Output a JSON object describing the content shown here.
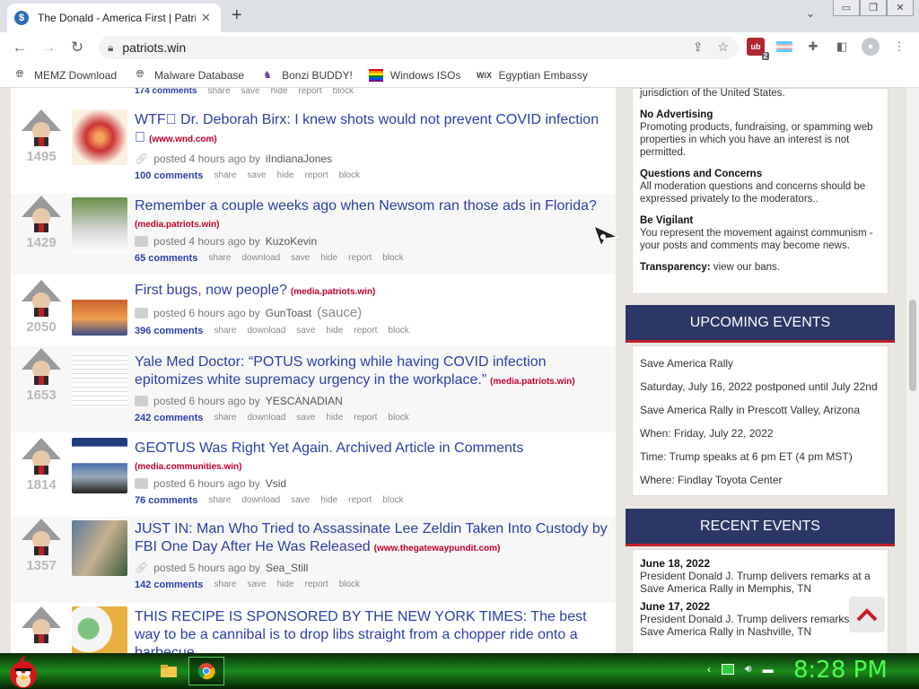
{
  "browser": {
    "tab_title": "The Donald - America First | Patriots.win",
    "tab_favicon_letter": "$",
    "url": "patriots.win",
    "window_buttons": [
      "▭",
      "❐",
      "✕"
    ],
    "ext_badge": "2",
    "bookmarks": [
      {
        "label": "MEMZ Download",
        "icon": "globe-icon"
      },
      {
        "label": "Malware Database",
        "icon": "globe-icon"
      },
      {
        "label": "Bonzi BUDDY!",
        "icon": "bonzi-icon"
      },
      {
        "label": "Windows ISOs",
        "icon": "windows-icon"
      },
      {
        "label": "Egyptian Embassy",
        "icon": "wix-icon"
      }
    ]
  },
  "feed": {
    "top_partial": [
      "174 comments",
      "share",
      "save",
      "hide",
      "report",
      "block"
    ],
    "posts": [
      {
        "votes": "1495",
        "title": "WTF\u0000 Dr. Deborah Birx: I knew shots would not prevent COVID infection \u0000",
        "domain": "(www.wnd.com)",
        "meta_prefix": "posted 4 hours ago by",
        "user": "iIndianaJones",
        "sauce": "",
        "comments": "100 comments",
        "actions": [
          "share",
          "save",
          "hide",
          "report",
          "block"
        ],
        "icon": "link-icon"
      },
      {
        "votes": "1429",
        "title": "Remember a couple weeks ago when Newsom ran those ads in Florida?",
        "domain": "(media.patriots.win)",
        "meta_prefix": "posted 4 hours ago by",
        "user": "KuzoKevin",
        "sauce": "",
        "comments": "65 comments",
        "actions": [
          "share",
          "download",
          "save",
          "hide",
          "report",
          "block"
        ],
        "icon": "camera-icon"
      },
      {
        "votes": "2050",
        "title": "First bugs, now people?",
        "domain": "(media.patriots.win)",
        "meta_prefix": "posted 6 hours ago by",
        "user": "GunToast",
        "sauce": "(sauce)",
        "comments": "396 comments",
        "actions": [
          "share",
          "download",
          "save",
          "hide",
          "report",
          "block"
        ],
        "icon": "camera-icon"
      },
      {
        "votes": "1653",
        "title": "Yale Med Doctor: “POTUS working while having COVID infection epitomizes white supremacy urgency in the workplace.”",
        "domain": "(media.patriots.win)",
        "meta_prefix": "posted 6 hours ago by",
        "user": "YESCANADIAN",
        "sauce": "",
        "comments": "242 comments",
        "actions": [
          "share",
          "download",
          "save",
          "hide",
          "report",
          "block"
        ],
        "icon": "camera-icon"
      },
      {
        "votes": "1814",
        "title": "GEOTUS Was Right Yet Again. Archived Article in Comments",
        "domain": "(media.communities.win)",
        "meta_prefix": "posted 6 hours ago by",
        "user": "Vsid",
        "sauce": "",
        "comments": "76 comments",
        "actions": [
          "share",
          "download",
          "save",
          "hide",
          "report",
          "block"
        ],
        "icon": "camera-icon"
      },
      {
        "votes": "1357",
        "title": "JUST IN: Man Who Tried to Assassinate Lee Zeldin Taken Into Custody by FBI One Day After He Was Released",
        "domain": "(www.thegatewaypundit.com)",
        "meta_prefix": "posted 5 hours ago by",
        "user": "Sea_Still",
        "sauce": "",
        "comments": "142 comments",
        "actions": [
          "share",
          "save",
          "hide",
          "report",
          "block"
        ],
        "icon": "link-icon"
      },
      {
        "votes": "",
        "title": "THIS RECIPE IS SPONSORED BY THE NEW YORK TIMES: The best way to be a cannibal is to drop libs straight from a chopper ride onto a barbecue",
        "domain": "",
        "meta_prefix": "",
        "user": "",
        "sauce": "",
        "comments": "",
        "actions": [],
        "icon": ""
      }
    ]
  },
  "sidebar": {
    "rules_top": "jurisdiction of the United States.",
    "rules": [
      {
        "head": "No Advertising",
        "text": "Promoting products, fundraising, or spamming web properties in which you have an interest is not permitted."
      },
      {
        "head": "Questions and Concerns",
        "text": "All moderation questions and concerns should be expressed privately to the moderators.."
      },
      {
        "head": "Be Vigilant",
        "text": "You represent the movement against communism - your posts and comments may become news."
      }
    ],
    "transparency_label": "Transparency:",
    "transparency_link": "view our bans.",
    "upcoming_title": "UPCOMING EVENTS",
    "upcoming": [
      "Save America Rally",
      "Saturday, July 16, 2022 postponed until July 22nd",
      "Save America Rally in Prescott Valley, Arizona",
      "When: Friday, July 22, 2022",
      "Time: Trump speaks at 6 pm ET (4 pm MST)",
      "Where: Findlay Toyota Center"
    ],
    "recent_title": "RECENT EVENTS",
    "recent": [
      {
        "date": "June 18, 2022",
        "text": "President Donald J. Trump delivers remarks at a Save America Rally in Memphis, TN"
      },
      {
        "date": "June 17, 2022",
        "text": "President Donald J. Trump delivers remarks at a Save America Rally in Nashville, TN"
      }
    ]
  },
  "taskbar": {
    "clock": "8:28 PM"
  }
}
